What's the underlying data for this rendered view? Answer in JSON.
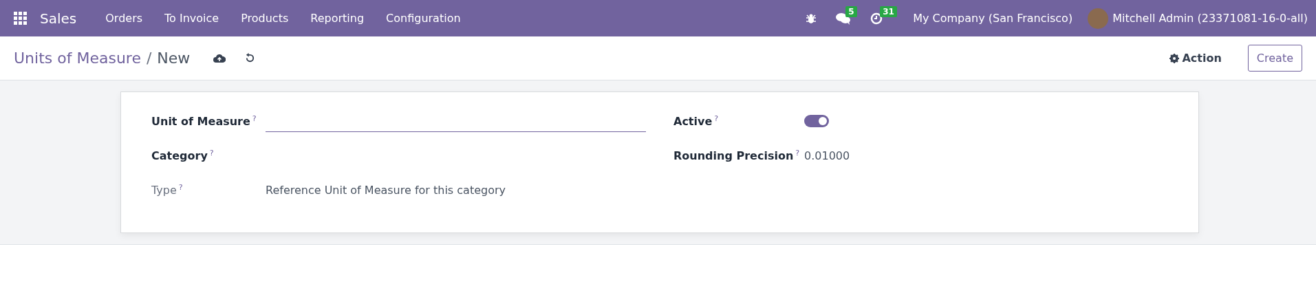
{
  "navbar": {
    "app": "Sales",
    "menu": [
      {
        "label": "Orders"
      },
      {
        "label": "To Invoice"
      },
      {
        "label": "Products"
      },
      {
        "label": "Reporting"
      },
      {
        "label": "Configuration"
      }
    ],
    "messages_badge": "5",
    "activities_badge": "31",
    "company": "My Company (San Francisco)",
    "user": "Mitchell Admin (23371081-16-0-all)"
  },
  "control_panel": {
    "breadcrumb": "Units of Measure",
    "separator": "/",
    "current": "New",
    "action": "Action",
    "create": "Create"
  },
  "form": {
    "left": [
      {
        "label": "Unit of Measure",
        "help": "?",
        "kind": "input",
        "bold": true
      },
      {
        "label": "Category",
        "help": "?",
        "kind": "empty",
        "bold": true
      },
      {
        "label": "Type",
        "help": "?",
        "kind": "text",
        "bold": false,
        "value": "Reference Unit of Measure for this category"
      }
    ],
    "right": [
      {
        "label": "Active",
        "help": "?",
        "kind": "toggle",
        "bold": true,
        "on": true
      },
      {
        "label": "Rounding Precision",
        "help": "?",
        "kind": "text",
        "bold": true,
        "value": "0.01000"
      }
    ]
  }
}
